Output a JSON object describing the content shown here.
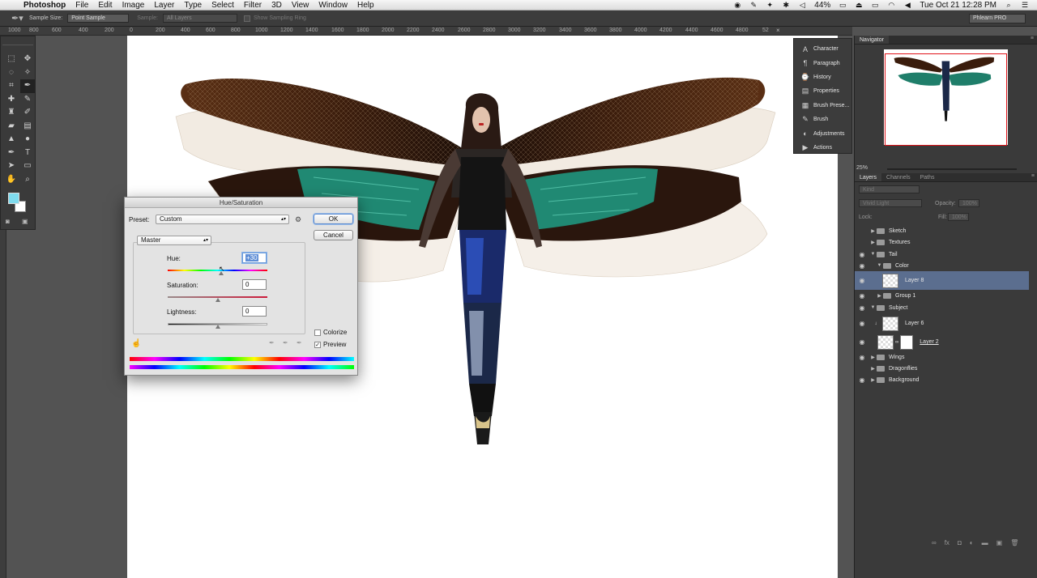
{
  "menubar": {
    "app": "Photoshop",
    "menus": [
      "File",
      "Edit",
      "Image",
      "Layer",
      "Type",
      "Select",
      "Filter",
      "3D",
      "View",
      "Window",
      "Help"
    ],
    "battery": "44%",
    "clock": "Tue Oct 21  12:28 PM"
  },
  "options": {
    "sample_size_label": "Sample Size:",
    "sample_size_value": "Point Sample",
    "sample_label": "Sample:",
    "sample_value": "All Layers",
    "show_ring": "Show Sampling Ring",
    "workspace": "Phlearn PRO"
  },
  "ruler": {
    "ticks": [
      "1000",
      "800",
      "600",
      "400",
      "200",
      "0",
      "200",
      "400",
      "600",
      "800",
      "1000",
      "1200",
      "1400",
      "1600",
      "1800",
      "2000",
      "2200",
      "2400",
      "2600",
      "2800",
      "3000",
      "3200",
      "3400",
      "3600",
      "3800",
      "4000",
      "4200",
      "4400",
      "4600",
      "4800",
      "52"
    ]
  },
  "colors": {
    "foreground": "#7fdbee",
    "background": "#ffffff",
    "selection": "#5b6e8f",
    "navigator_frame": "#e0141a"
  },
  "collapsed_panels": [
    {
      "icon": "character-icon",
      "label": "Character"
    },
    {
      "icon": "paragraph-icon",
      "label": "Paragraph"
    },
    {
      "icon": "history-icon",
      "label": "History"
    },
    {
      "icon": "properties-icon",
      "label": "Properties"
    },
    {
      "icon": "brush-presets-icon",
      "label": "Brush Prese..."
    },
    {
      "icon": "brush-icon",
      "label": "Brush"
    },
    {
      "icon": "adjustments-icon",
      "label": "Adjustments"
    },
    {
      "icon": "actions-icon",
      "label": "Actions"
    }
  ],
  "navigator": {
    "tab": "Navigator",
    "zoom": "25%"
  },
  "layers": {
    "tabs": [
      "Layers",
      "Channels",
      "Paths"
    ],
    "kind": "Kind",
    "blend_mode": "Vivid Light",
    "opacity_label": "Opacity:",
    "opacity_value": "100%",
    "lock_label": "Lock:",
    "fill_label": "Fill:",
    "fill_value": "100%",
    "rows": [
      {
        "name": "Sketch",
        "type": "group"
      },
      {
        "name": "Textures",
        "type": "group"
      },
      {
        "name": "Tail",
        "type": "group-open"
      },
      {
        "name": "Color",
        "type": "group-open"
      },
      {
        "name": "Layer 8",
        "type": "layer"
      },
      {
        "name": "Group 1",
        "type": "group"
      },
      {
        "name": "Subject",
        "type": "group-open"
      },
      {
        "name": "Layer 6",
        "type": "layer"
      },
      {
        "name": "Layer 2",
        "type": "layer"
      },
      {
        "name": "Wings",
        "type": "group"
      },
      {
        "name": "Dragonflies",
        "type": "group"
      },
      {
        "name": "Background",
        "type": "group"
      }
    ]
  },
  "dialog": {
    "title": "Hue/Saturation",
    "preset_label": "Preset:",
    "preset_value": "Custom",
    "ok": "OK",
    "cancel": "Cancel",
    "channel": "Master",
    "hue_label": "Hue:",
    "hue_value": "+30",
    "hue_position": 0.54,
    "saturation_label": "Saturation:",
    "saturation_value": "0",
    "saturation_position": 0.5,
    "lightness_label": "Lightness:",
    "lightness_value": "0",
    "lightness_position": 0.5,
    "colorize": "Colorize",
    "preview": "Preview"
  }
}
